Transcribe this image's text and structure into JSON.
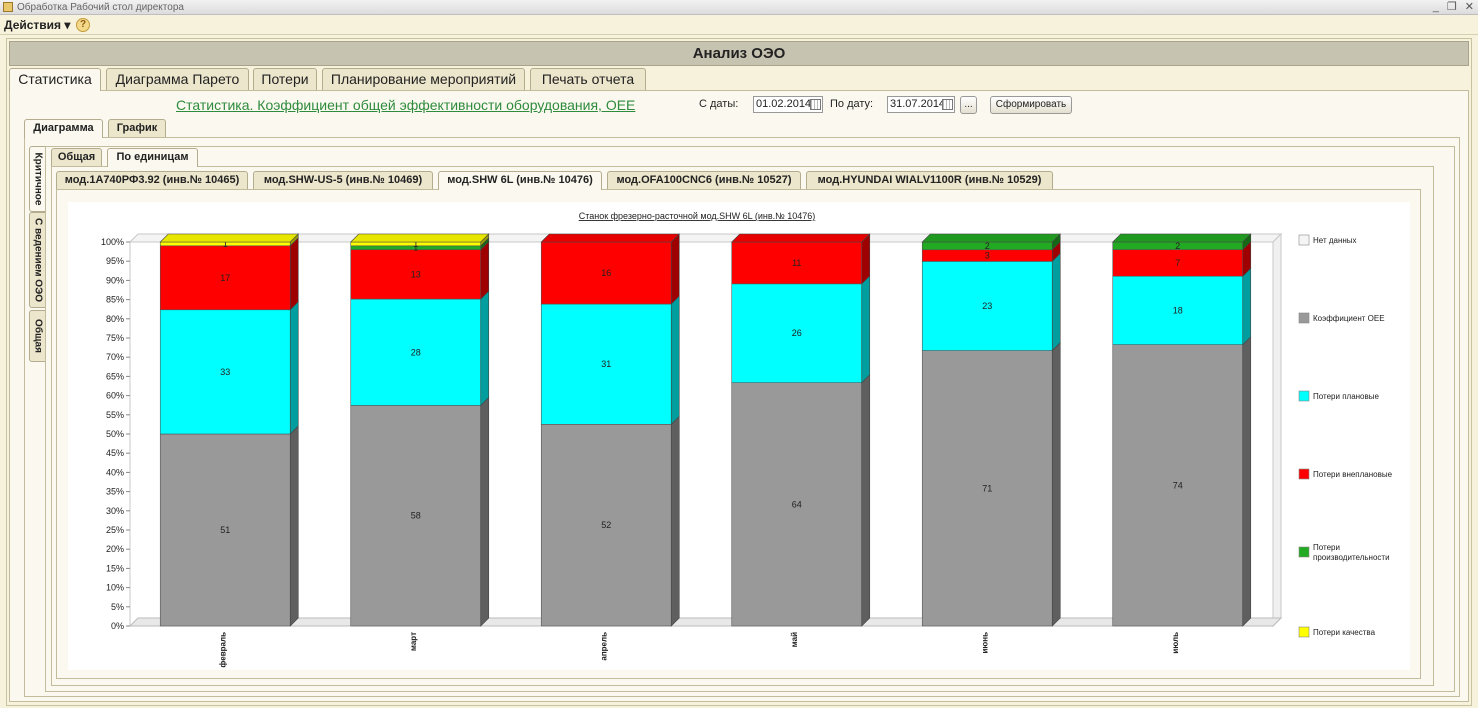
{
  "window": {
    "title": "Обработка  Рабочий стол директора"
  },
  "menu": {
    "actions": "Действия",
    "help": "?"
  },
  "header": {
    "title": "Анализ  ОЭО"
  },
  "main_tabs": [
    "Статистика",
    "Диаграмма Парето",
    "Потери",
    "Планирование мероприятий",
    "Печать отчета"
  ],
  "report": {
    "link": "Статистика. Коэффициент общей эффективности оборудования, OEE",
    "from_label": "С даты:",
    "from_value": "01.02.2014",
    "to_label": "По дату:",
    "to_value": "31.07.2014",
    "ellipsis": "...",
    "generate": "Сформировать"
  },
  "view_tabs": [
    "Диаграмма",
    "График"
  ],
  "side_tabs": [
    "Критичное",
    "С ведением ОЭО",
    "Общая"
  ],
  "group_tabs": [
    "Общая",
    "По единицам"
  ],
  "machine_tabs": [
    "мод.1А740РФ3.92 (инв.№ 10465)",
    "мод.SHW-US-5 (инв.№ 10469)",
    "мод.SHW 6L (инв.№ 10476)",
    "мод.OFA100CNC6 (инв.№ 10527)",
    "мод.HYUNDAI WIALV1100R (инв.№ 10529)"
  ],
  "chart_data": {
    "type": "bar",
    "stacked": true,
    "percent": true,
    "title": "Станок фрезерно-расточной мод.SHW 6L (инв.№ 10476)",
    "categories": [
      "февраль",
      "март",
      "апрель",
      "май",
      "июнь",
      "июль"
    ],
    "yticks": [
      "0%",
      "5%",
      "10%",
      "15%",
      "20%",
      "25%",
      "30%",
      "35%",
      "40%",
      "45%",
      "50%",
      "55%",
      "60%",
      "65%",
      "70%",
      "75%",
      "80%",
      "85%",
      "90%",
      "95%",
      "100%"
    ],
    "ylim": [
      0,
      100
    ],
    "legend_position": "right",
    "series": [
      {
        "name": "Коэффициент ОЕЕ",
        "color": "#999999",
        "values": [
          51,
          58,
          52,
          64,
          71,
          74
        ]
      },
      {
        "name": "Потери плановые",
        "color": "#00ffff",
        "values": [
          33,
          28,
          31,
          26,
          23,
          18
        ]
      },
      {
        "name": "Потери внеплановые",
        "color": "#ff0000",
        "values": [
          17,
          13,
          16,
          11,
          3,
          7
        ]
      },
      {
        "name": "Потери производительности",
        "color": "#22aa22",
        "values": [
          0,
          1,
          0,
          0,
          2,
          2
        ]
      },
      {
        "name": "Потери качества",
        "color": "#ffff00",
        "values": [
          1,
          1,
          0,
          0,
          0,
          0
        ]
      }
    ],
    "legend": [
      "Нет данных",
      "Коэффициент ОЕЕ",
      "Потери плановые",
      "Потери внеплановые",
      "Потери производительности",
      "Потери качества"
    ],
    "legend_colors": [
      "#f5f5f5",
      "#999999",
      "#00ffff",
      "#ff0000",
      "#22aa22",
      "#ffff00"
    ]
  }
}
